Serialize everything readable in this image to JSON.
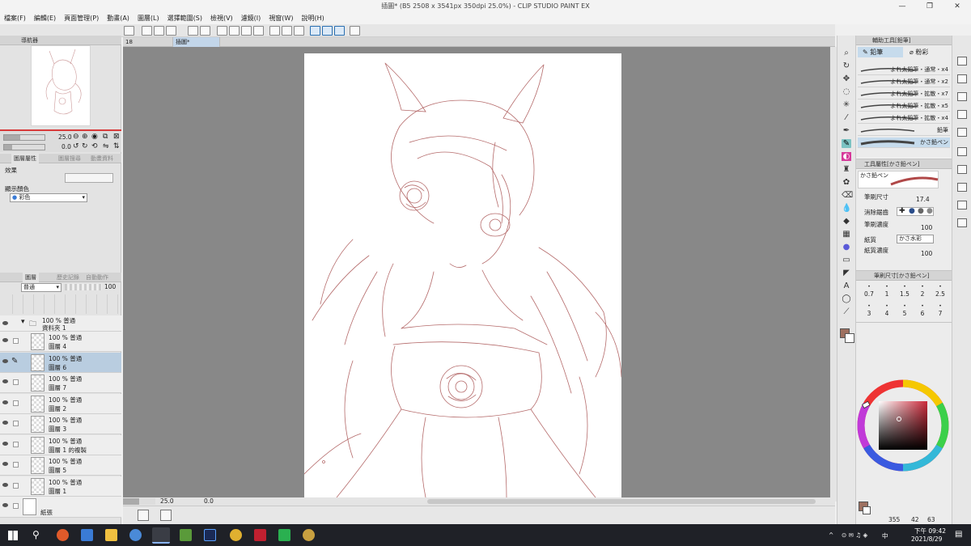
{
  "window": {
    "title": "插圖* (B5 2508 x 3541px 350dpi 25.0%) - CLIP STUDIO PAINT EX",
    "minimize": "—",
    "maximize": "❐",
    "close": "✕"
  },
  "menu": [
    "檔案(F)",
    "編輯(E)",
    "頁面管理(P)",
    "動畫(A)",
    "圖層(L)",
    "選擇範圍(S)",
    "檢視(V)",
    "濾鏡(I)",
    "視窗(W)",
    "說明(H)"
  ],
  "canvas": {
    "tabs": [
      "18",
      "插圖*"
    ],
    "zoom": "25.0",
    "angle": "0.0"
  },
  "navigator": {
    "title": "導航器",
    "zoom": "25.0",
    "angle": "0.0"
  },
  "layer_property": {
    "tabs": [
      "圖層屬性",
      "圖層搜尋",
      "動畫資料"
    ],
    "effect_label": "效果",
    "display_color_label": "顯示顏色",
    "display_color_value": "彩色"
  },
  "layers_panel": {
    "tabs": [
      "圖層",
      "歷史記錄",
      "自動動作"
    ],
    "blend_mode": "普通",
    "opacity": "100",
    "folder": {
      "line1": "100 % 普通",
      "line2": "資料夾 1"
    },
    "layers": [
      {
        "line1": "100 % 普通",
        "line2": "圖層 4",
        "selected": false
      },
      {
        "line1": "100 % 普通",
        "line2": "圖層 6",
        "selected": true
      },
      {
        "line1": "100 % 普通",
        "line2": "圖層 7",
        "selected": false
      },
      {
        "line1": "100 % 普通",
        "line2": "圖層 2",
        "selected": false
      },
      {
        "line1": "100 % 普通",
        "line2": "圖層 3",
        "selected": false
      },
      {
        "line1": "100 % 普通",
        "line2": "圖層 1 的複製",
        "selected": false
      },
      {
        "line1": "100 % 普通",
        "line2": "圖層 5",
        "selected": false
      },
      {
        "line1": "100 % 普通",
        "line2": "圖層 1",
        "selected": false
      }
    ],
    "paper_layer": "紙張"
  },
  "subtool": {
    "title": "輔助工具[鉛筆]",
    "tabs": [
      "鉛筆",
      "粉彩"
    ],
    "brushes": [
      {
        "name": "よれ太鉛筆・通常・x4",
        "selected": false
      },
      {
        "name": "よれ太鉛筆・通常・x2",
        "selected": false
      },
      {
        "name": "よれ太鉛筆・拡散・x7",
        "selected": false
      },
      {
        "name": "よれ太鉛筆・拡散・x5",
        "selected": false
      },
      {
        "name": "よれ太鉛筆・拡散・x4",
        "selected": false
      },
      {
        "name": "鉛筆",
        "selected": false
      },
      {
        "name": "かさ鉛ペン",
        "selected": true
      }
    ]
  },
  "tool_property": {
    "title": "工具屬性[かさ鉛ペン]",
    "preview_name": "かさ鉛ペン",
    "brush_size_label": "筆刷尺寸",
    "brush_size": "17.4",
    "antialias_label": "消除鋸齒",
    "brush_density_label": "筆刷濃度",
    "brush_density": "100",
    "paper_texture_label": "紙質",
    "paper_texture_value": "かさ水彩",
    "paper_density_label": "紙質濃度",
    "paper_density": "100"
  },
  "brush_size_panel": {
    "title": "筆刷尺寸[かさ鉛ペン]",
    "row1": [
      "0.7",
      "1",
      "1.5",
      "2",
      "2.5"
    ],
    "row2": [
      "3",
      "4",
      "5",
      "6",
      "7"
    ]
  },
  "color": {
    "main": "#9e7060",
    "sub": "#ffffff",
    "pen": "#b04848",
    "accent": "#d73a3a",
    "selection": "#b9cde0",
    "wheel_square": "#cc2a3a"
  },
  "status": {
    "x": "355",
    "y": "42",
    "z": "63"
  },
  "taskbar": {
    "time_label": "下午 09:42",
    "date": "2021/8/29",
    "ime": "中"
  }
}
